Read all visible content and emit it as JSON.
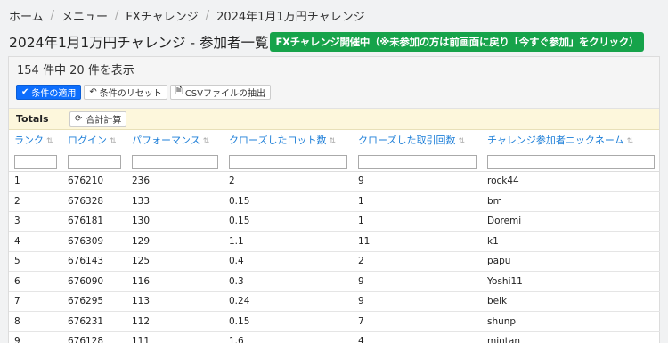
{
  "breadcrumb": [
    "ホーム",
    "メニュー",
    "FXチャレンジ",
    "2024年1月1万円チャレンジ"
  ],
  "page_title": "2024年1月1万円チャレンジ - 参加者一覧",
  "status_badge": "FXチャレンジ開催中（※未参加の方は前画面に戻り「今すぐ参加」をクリック）",
  "count_text": "154 件中 20 件を表示",
  "buttons": {
    "apply": "条件の適用",
    "reset": "条件のリセット",
    "csv": "CSVファイルの抽出"
  },
  "totals": {
    "label": "Totals",
    "recalc": "合計計算"
  },
  "columns": [
    "ランク",
    "ログイン",
    "パフォーマンス",
    "クローズしたロット数",
    "クローズした取引回数",
    "チャレンジ参加者ニックネーム"
  ],
  "rows": [
    [
      "1",
      "676210",
      "236",
      "2",
      "9",
      "rock44"
    ],
    [
      "2",
      "676328",
      "133",
      "0.15",
      "1",
      "bm"
    ],
    [
      "3",
      "676181",
      "130",
      "0.15",
      "1",
      "Doremi"
    ],
    [
      "4",
      "676309",
      "129",
      "1.1",
      "11",
      "k1"
    ],
    [
      "5",
      "676143",
      "125",
      "0.4",
      "2",
      "papu"
    ],
    [
      "6",
      "676090",
      "116",
      "0.3",
      "9",
      "Yoshi11"
    ],
    [
      "7",
      "676295",
      "113",
      "0.24",
      "9",
      "beik"
    ],
    [
      "8",
      "676231",
      "112",
      "0.15",
      "7",
      "shunp"
    ],
    [
      "9",
      "676128",
      "111",
      "1.6",
      "4",
      "mintan"
    ]
  ],
  "colors": {
    "accent": "#1e7fd8",
    "badge": "#16a34a",
    "primary": "#0d6efd"
  }
}
